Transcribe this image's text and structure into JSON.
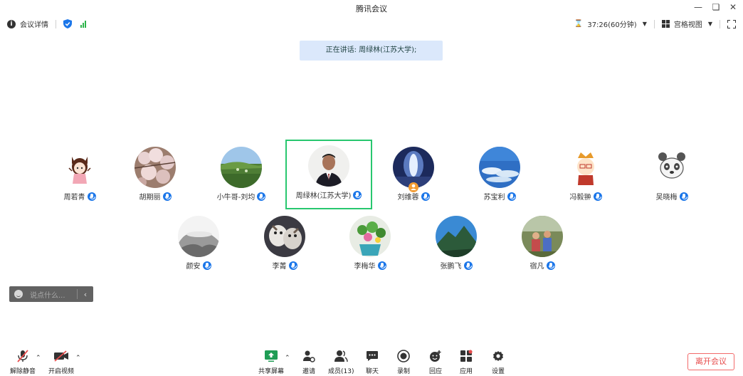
{
  "window": {
    "title": "腾讯会议",
    "controls": [
      "minimize-icon",
      "restore-icon",
      "close-icon"
    ]
  },
  "infobar": {
    "meeting_info_label": "会议详情",
    "timer": "37:26(60分钟)",
    "view_label": "宫格视图",
    "signal_color": "#2cb34a",
    "shield_color": "#1b76e9"
  },
  "speaking": {
    "text": "正在讲话: 周绿林(江苏大学);"
  },
  "participants": [
    {
      "name": "周若青",
      "avatar": "cartoon-girl",
      "active": false
    },
    {
      "name": "胡期丽",
      "avatar": "cherry-blossom",
      "active": false
    },
    {
      "name": "小牛哥-刘均",
      "avatar": "green-field",
      "active": false
    },
    {
      "name": "周绿林(江苏大学)",
      "avatar": "man-portrait",
      "active": true
    },
    {
      "name": "刘维蓉",
      "avatar": "blue-light",
      "active": false
    },
    {
      "name": "苏宝利",
      "avatar": "sky-clouds",
      "active": false
    },
    {
      "name": "冯毅翀",
      "avatar": "cartoon-boy",
      "active": false
    },
    {
      "name": "吴晓梅",
      "avatar": "cartoon-panda",
      "active": false
    },
    {
      "name": "颜安",
      "avatar": "ink-landscape",
      "active": false
    },
    {
      "name": "李菁",
      "avatar": "dogs",
      "active": false
    },
    {
      "name": "李梅华",
      "avatar": "flower-pot",
      "active": false
    },
    {
      "name": "张鹏飞",
      "avatar": "mountain",
      "active": false
    },
    {
      "name": "宿凡",
      "avatar": "people-outdoor",
      "active": false
    }
  ],
  "chat": {
    "placeholder": "说点什么..."
  },
  "toolbar": {
    "unmute_label": "解除静音",
    "video_label": "开启视频",
    "share_label": "共享屏幕",
    "invite_label": "邀请",
    "members_label": "成员(13)",
    "chat_label": "聊天",
    "record_label": "录制",
    "reaction_label": "回应",
    "apps_label": "应用",
    "settings_label": "设置",
    "leave_label": "离开会议",
    "accent_color": "#1b76e9",
    "danger_color": "#e74c4c"
  }
}
